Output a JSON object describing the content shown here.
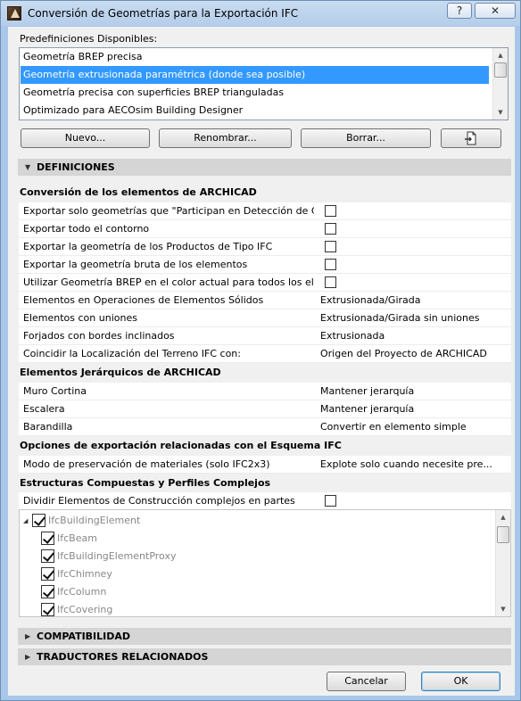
{
  "window": {
    "title": "Conversión de Geometrías para la Exportación IFC",
    "help_label": "?",
    "close_label": "✕"
  },
  "presets": {
    "label": "Predefiniciones Disponibles:",
    "items": [
      "Geometría BREP precisa",
      "Geometría extrusionada paramétrica (donde sea posible)",
      "Geometría precisa con superficies BREP trianguladas",
      "Optimizado para AECOsim Building Designer"
    ],
    "selected_index": 1
  },
  "preset_buttons": {
    "new": "Nuevo...",
    "rename": "Renombrar...",
    "delete": "Borrar..."
  },
  "sections": {
    "definitions": "DEFINICIONES",
    "compatibility": "COMPATIBILIDAD",
    "translators": "TRADUCTORES RELACIONADOS"
  },
  "groups": {
    "conversion": {
      "title": "Conversión de los elementos de ARCHICAD",
      "rows": [
        {
          "label": "Exportar solo geometrías que \"Participan en Detección de Coli...",
          "checked": false
        },
        {
          "label": "Exportar todo el contorno",
          "checked": false
        },
        {
          "label": "Exportar la geometría de los Productos de Tipo IFC",
          "checked": false
        },
        {
          "label": "Exportar la geometría bruta de los elementos",
          "checked": false
        },
        {
          "label": "Utilizar Geometría BREP en el color actual para todos los eleme...",
          "checked": false
        },
        {
          "label": "Elementos en Operaciones de Elementos Sólidos",
          "value": "Extrusionada/Girada"
        },
        {
          "label": "Elementos con uniones",
          "value": "Extrusionada/Girada sin uniones"
        },
        {
          "label": "Forjados con bordes inclinados",
          "value": "Extrusionada"
        },
        {
          "label": "Coincidir la Localización del Terreno IFC con:",
          "value": "Origen del Proyecto de ARCHICAD"
        }
      ]
    },
    "hierarchy": {
      "title": "Elementos Jerárquicos de ARCHICAD",
      "rows": [
        {
          "label": "Muro Cortina",
          "value": "Mantener jerarquía"
        },
        {
          "label": "Escalera",
          "value": "Mantener jerarquía"
        },
        {
          "label": "Barandilla",
          "value": "Convertir en elemento simple"
        }
      ]
    },
    "schema": {
      "title": "Opciones de exportación relacionadas con el Esquema IFC",
      "rows": [
        {
          "label": "Modo de preservación de materiales (solo IFC2x3)",
          "value": "Explote solo cuando necesite pre..."
        }
      ]
    },
    "composite": {
      "title": "Estructuras Compuestas y Perfiles Complejos",
      "rows": [
        {
          "label": "Dividir Elementos de Construcción complejos en partes",
          "checked": false
        }
      ]
    }
  },
  "tree": {
    "root": "IfcBuildingElement",
    "children": [
      "IfcBeam",
      "IfcBuildingElementProxy",
      "IfcChimney",
      "IfcColumn",
      "IfcCovering"
    ]
  },
  "footer": {
    "cancel": "Cancelar",
    "ok": "OK"
  }
}
